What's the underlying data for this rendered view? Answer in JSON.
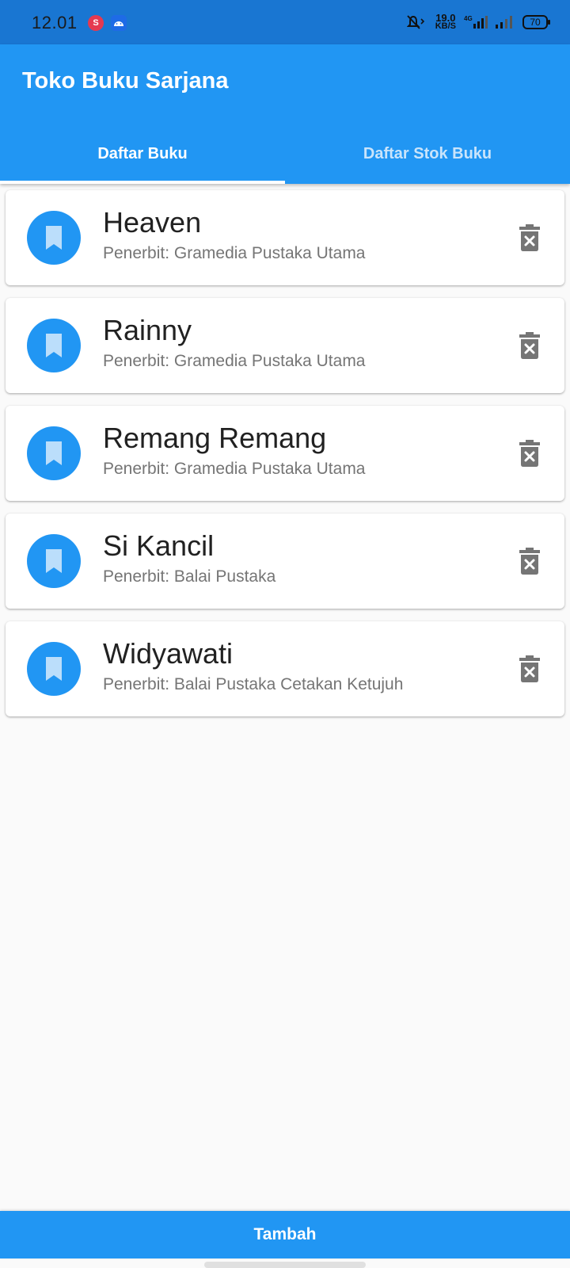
{
  "status_bar": {
    "time": "12.01",
    "speed_value": "19.0",
    "speed_unit": "KB/S",
    "network": "4G",
    "battery": "70"
  },
  "app_bar": {
    "title": "Toko Buku Sarjana",
    "tabs": [
      {
        "label": "Daftar Buku",
        "selected": true
      },
      {
        "label": "Daftar Stok Buku",
        "selected": false
      }
    ]
  },
  "books": [
    {
      "title": "Heaven",
      "publisher": "Penerbit: Gramedia Pustaka Utama"
    },
    {
      "title": "Rainny",
      "publisher": "Penerbit: Gramedia Pustaka Utama"
    },
    {
      "title": "Remang Remang",
      "publisher": "Penerbit: Gramedia Pustaka Utama"
    },
    {
      "title": "Si Kancil",
      "publisher": "Penerbit: Balai Pustaka"
    },
    {
      "title": "Widyawati",
      "publisher": "Penerbit: Balai Pustaka Cetakan Ketujuh"
    }
  ],
  "icons": {
    "avatar": "bookmark-icon",
    "action": "delete-forever-icon"
  },
  "bottom_button": {
    "label": "Tambah"
  },
  "colors": {
    "primary": "#2196f3",
    "status_bar": "#1976d2",
    "background": "#fafafa",
    "icon_grey": "#757575"
  }
}
